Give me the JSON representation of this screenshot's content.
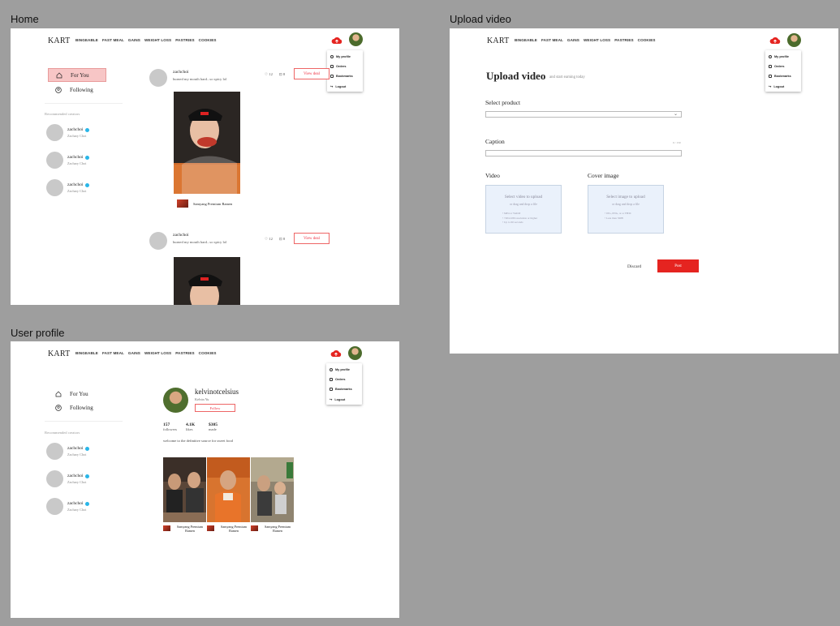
{
  "frames": {
    "home": "Home",
    "upload": "Upload video",
    "profile": "User profile"
  },
  "nav": {
    "brand": "KART",
    "links": [
      "BINGEABLE",
      "FAST MEAL",
      "GAINS",
      "WEIGHT LOSS",
      "PASTRIES",
      "COOKIES"
    ]
  },
  "menu": {
    "items": [
      "My profile",
      "Orders",
      "Bookmarks",
      "Logout"
    ]
  },
  "sidebar": {
    "for_you": "For You",
    "following": "Following",
    "recommended_title": "Recommended creators",
    "creators": [
      {
        "handle": "zachchoi",
        "name": "Zachary Choi"
      },
      {
        "handle": "zachchoi",
        "name": "Zachary Choi"
      },
      {
        "handle": "zachchoi",
        "name": "Zachary Choi"
      }
    ]
  },
  "feed": {
    "posts": [
      {
        "user": "zachchoi",
        "caption": "burned my mouth hard...so spicy lol",
        "likes": "12",
        "carts": "8",
        "cta": "View deal",
        "product": "Samyang Premium Ramen"
      },
      {
        "user": "zachchoi",
        "caption": "burned my mouth hard...so spicy lol",
        "likes": "12",
        "carts": "8",
        "cta": "View deal"
      }
    ]
  },
  "upload": {
    "title": "Upload video",
    "subtitle": "and start earning today",
    "select_product": "Select product",
    "caption_label": "Caption",
    "caption_counter": "0 / 150",
    "video_label": "Video",
    "video_main": "Select video to upload",
    "video_sub": "or drag and drop a file",
    "video_reqs": [
      "• MP4 or WebM",
      "• 720x1280 resolution or higher",
      "• Up to 60 seconds"
    ],
    "cover_label": "Cover image",
    "cover_main": "Select image to upload",
    "cover_sub": "or drag and drop a file",
    "cover_reqs": [
      "• JPG, PNG, or or HEIC",
      "• Less than 5MB"
    ],
    "discard": "Discard",
    "post": "Post"
  },
  "profile": {
    "username": "kelvinotcelsius",
    "real_name": "Kelvin Yu",
    "follow": "Follow",
    "stats": [
      {
        "value": "157",
        "label": "followers"
      },
      {
        "value": "4.1K",
        "label": "likes"
      },
      {
        "value": "$305",
        "label": "made"
      }
    ],
    "bio": "welcome to the definitive source for sweet food",
    "videos": [
      {
        "caption": "Samyang Premium Ramen"
      },
      {
        "caption": "Samyang Premium Ramen"
      },
      {
        "caption": "Samyang Premium Ramen"
      }
    ]
  },
  "colors": {
    "accent": "#e52420",
    "active_nav": "#f7c6c6",
    "verified": "#29b6e8",
    "canvas": "#9e9e9e"
  }
}
